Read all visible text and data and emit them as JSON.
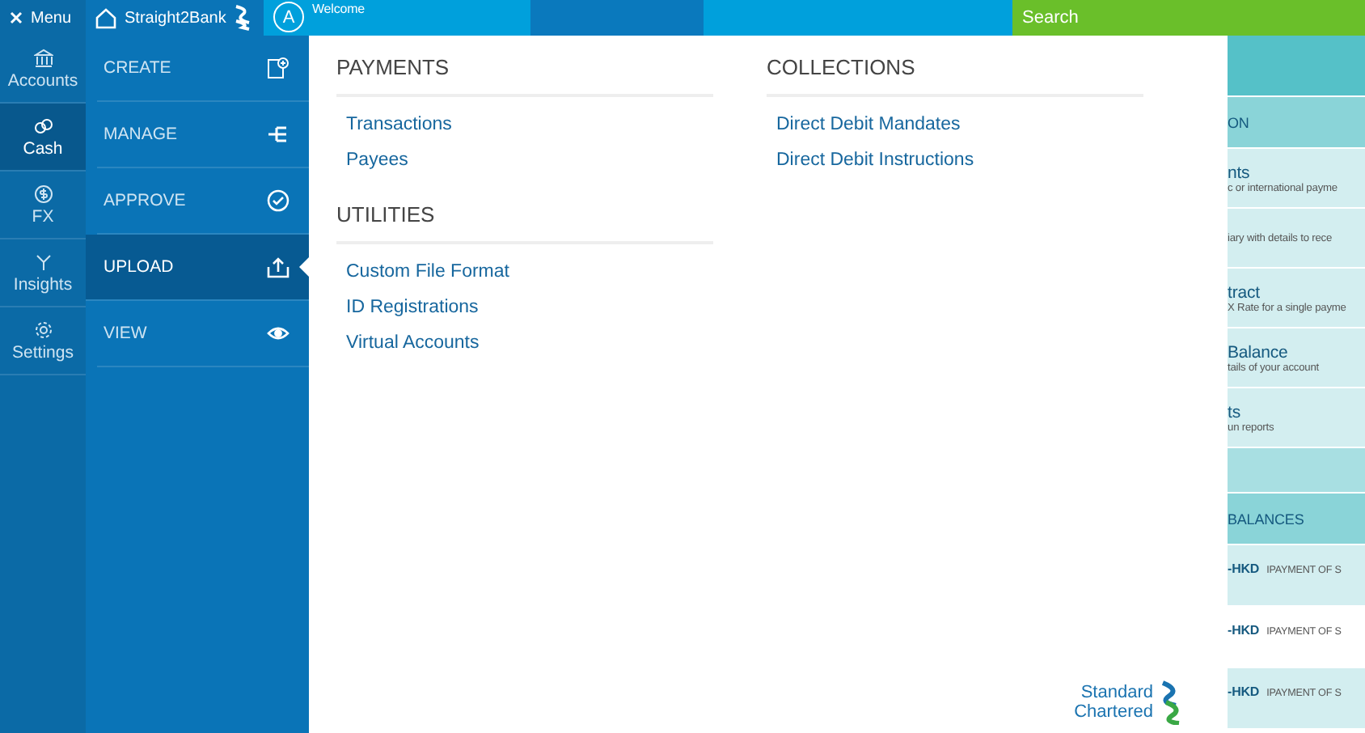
{
  "topbar": {
    "menu_label": "Menu",
    "brand": "Straight2Bank",
    "avatar": "A",
    "welcome": "Welcome",
    "search": "Search"
  },
  "rail": [
    {
      "label": "Accounts",
      "selected": false
    },
    {
      "label": "Cash",
      "selected": true
    },
    {
      "label": "FX",
      "selected": false
    },
    {
      "label": "Insights",
      "selected": false
    },
    {
      "label": "Settings",
      "selected": false
    }
  ],
  "submenu": [
    {
      "label": "CREATE",
      "selected": false
    },
    {
      "label": "MANAGE",
      "selected": false
    },
    {
      "label": "APPROVE",
      "selected": false
    },
    {
      "label": "UPLOAD",
      "selected": true
    },
    {
      "label": "VIEW",
      "selected": false
    }
  ],
  "panel": {
    "columns": [
      [
        {
          "heading": "PAYMENTS",
          "links": [
            "Transactions",
            "Payees"
          ]
        },
        {
          "heading": "UTILITIES",
          "links": [
            "Custom File Format",
            "ID Registrations",
            "Virtual Accounts"
          ]
        }
      ],
      [
        {
          "heading": "COLLECTIONS",
          "links": [
            "Direct Debit Mandates",
            "Direct Debit Instructions"
          ]
        }
      ]
    ],
    "logo": [
      "Standard",
      "Chartered"
    ]
  },
  "background": {
    "rows": [
      {
        "kind": "band"
      },
      {
        "kind": "header",
        "text": "ON"
      },
      {
        "kind": "item",
        "title": "nts",
        "sub": "c or international payme"
      },
      {
        "kind": "item",
        "title": "",
        "sub": "iary with details to rece"
      },
      {
        "kind": "item",
        "title": "tract",
        "sub": "X Rate for a single payme"
      },
      {
        "kind": "item",
        "title": "Balance",
        "sub": "tails of your account"
      },
      {
        "kind": "item",
        "title": "ts",
        "sub": "un reports"
      },
      {
        "kind": "band"
      },
      {
        "kind": "header",
        "text": "BALANCES"
      },
      {
        "kind": "balance",
        "code": "-HKD",
        "desc": "IPAYMENT OF S",
        "shaded": true
      },
      {
        "kind": "balance",
        "code": "-HKD",
        "desc": "IPAYMENT OF S",
        "shaded": false
      },
      {
        "kind": "balance",
        "code": "-HKD",
        "desc": "IPAYMENT OF S",
        "shaded": true
      }
    ]
  }
}
